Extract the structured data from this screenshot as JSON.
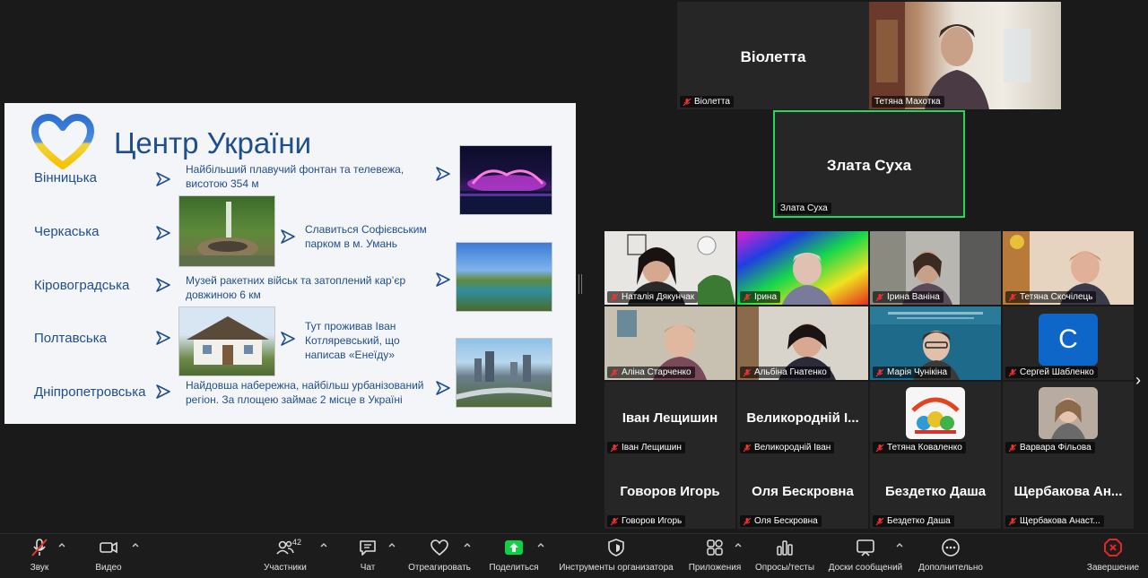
{
  "slide": {
    "title": "Центр України",
    "rows": [
      {
        "region": "Вінницька",
        "desc": "Найбільший плавучий фонтан та телевежа, висотою 354 м"
      },
      {
        "region": "Черкаська",
        "desc": "Славиться Софієвським парком в м. Умань"
      },
      {
        "region": "Кіровоградська",
        "desc": "Музей ракетних військ та затоплений кар’єр довжиною 6 км"
      },
      {
        "region": "Полтавська",
        "desc": "Тут проживав Іван Котляревський, що написав «Енеїду»"
      },
      {
        "region": "Дніпропетровська",
        "desc": "Найдовша набережна, найбільш урбанізований регіон. За площею займає 2 місце в Україні"
      }
    ]
  },
  "pinned": [
    {
      "big_name": "Віолетта",
      "name": "Віолетта"
    },
    {
      "name": "Тетяна Махотка"
    },
    {
      "big_name": "Злата Суха",
      "name": "Злата Суха"
    }
  ],
  "gallery": [
    {
      "name": "Наталія Дякунчак"
    },
    {
      "name": "Ірина"
    },
    {
      "name": "Ірина Ваніна"
    },
    {
      "name": "Тетяна Скочілець"
    },
    {
      "name": "Аліна Старченко"
    },
    {
      "name": "Альбіна Гнатенко"
    },
    {
      "name": "Марія Чунікіна"
    },
    {
      "name": "Сергей Шабленко",
      "avatar_letter": "С"
    },
    {
      "big_name": "Іван Лещишин",
      "name": "Іван Лещишин"
    },
    {
      "big_name": "Великородній І...",
      "name": "Великородній Іван"
    },
    {
      "name": "Тетяна Коваленко"
    },
    {
      "name": "Варвара Фільова"
    },
    {
      "big_name": "Говоров Игорь",
      "name": "Говоров Игорь"
    },
    {
      "big_name": "Оля Бескровна",
      "name": "Оля Бескровна"
    },
    {
      "big_name": "Бездетко Даша",
      "name": "Бездетко Даша"
    },
    {
      "big_name": "Щербакова Ан...",
      "name": "Щербакова Анаст..."
    }
  ],
  "toolbar": {
    "mute": "Звук",
    "video": "Видео",
    "participants": "Участники",
    "participants_count": "42",
    "chat": "Чат",
    "react": "Отреагировать",
    "share": "Поделиться",
    "host_tools": "Инструменты организатора",
    "apps": "Приложения",
    "polls": "Опросы/тесты",
    "whiteboards": "Доски сообщений",
    "more": "Дополнительно",
    "end": "Завершение"
  },
  "colors": {
    "accent_green": "#23d959",
    "share_green": "#0ed145",
    "end_red": "#e02828",
    "slide_blue": "#1f4e8c"
  }
}
